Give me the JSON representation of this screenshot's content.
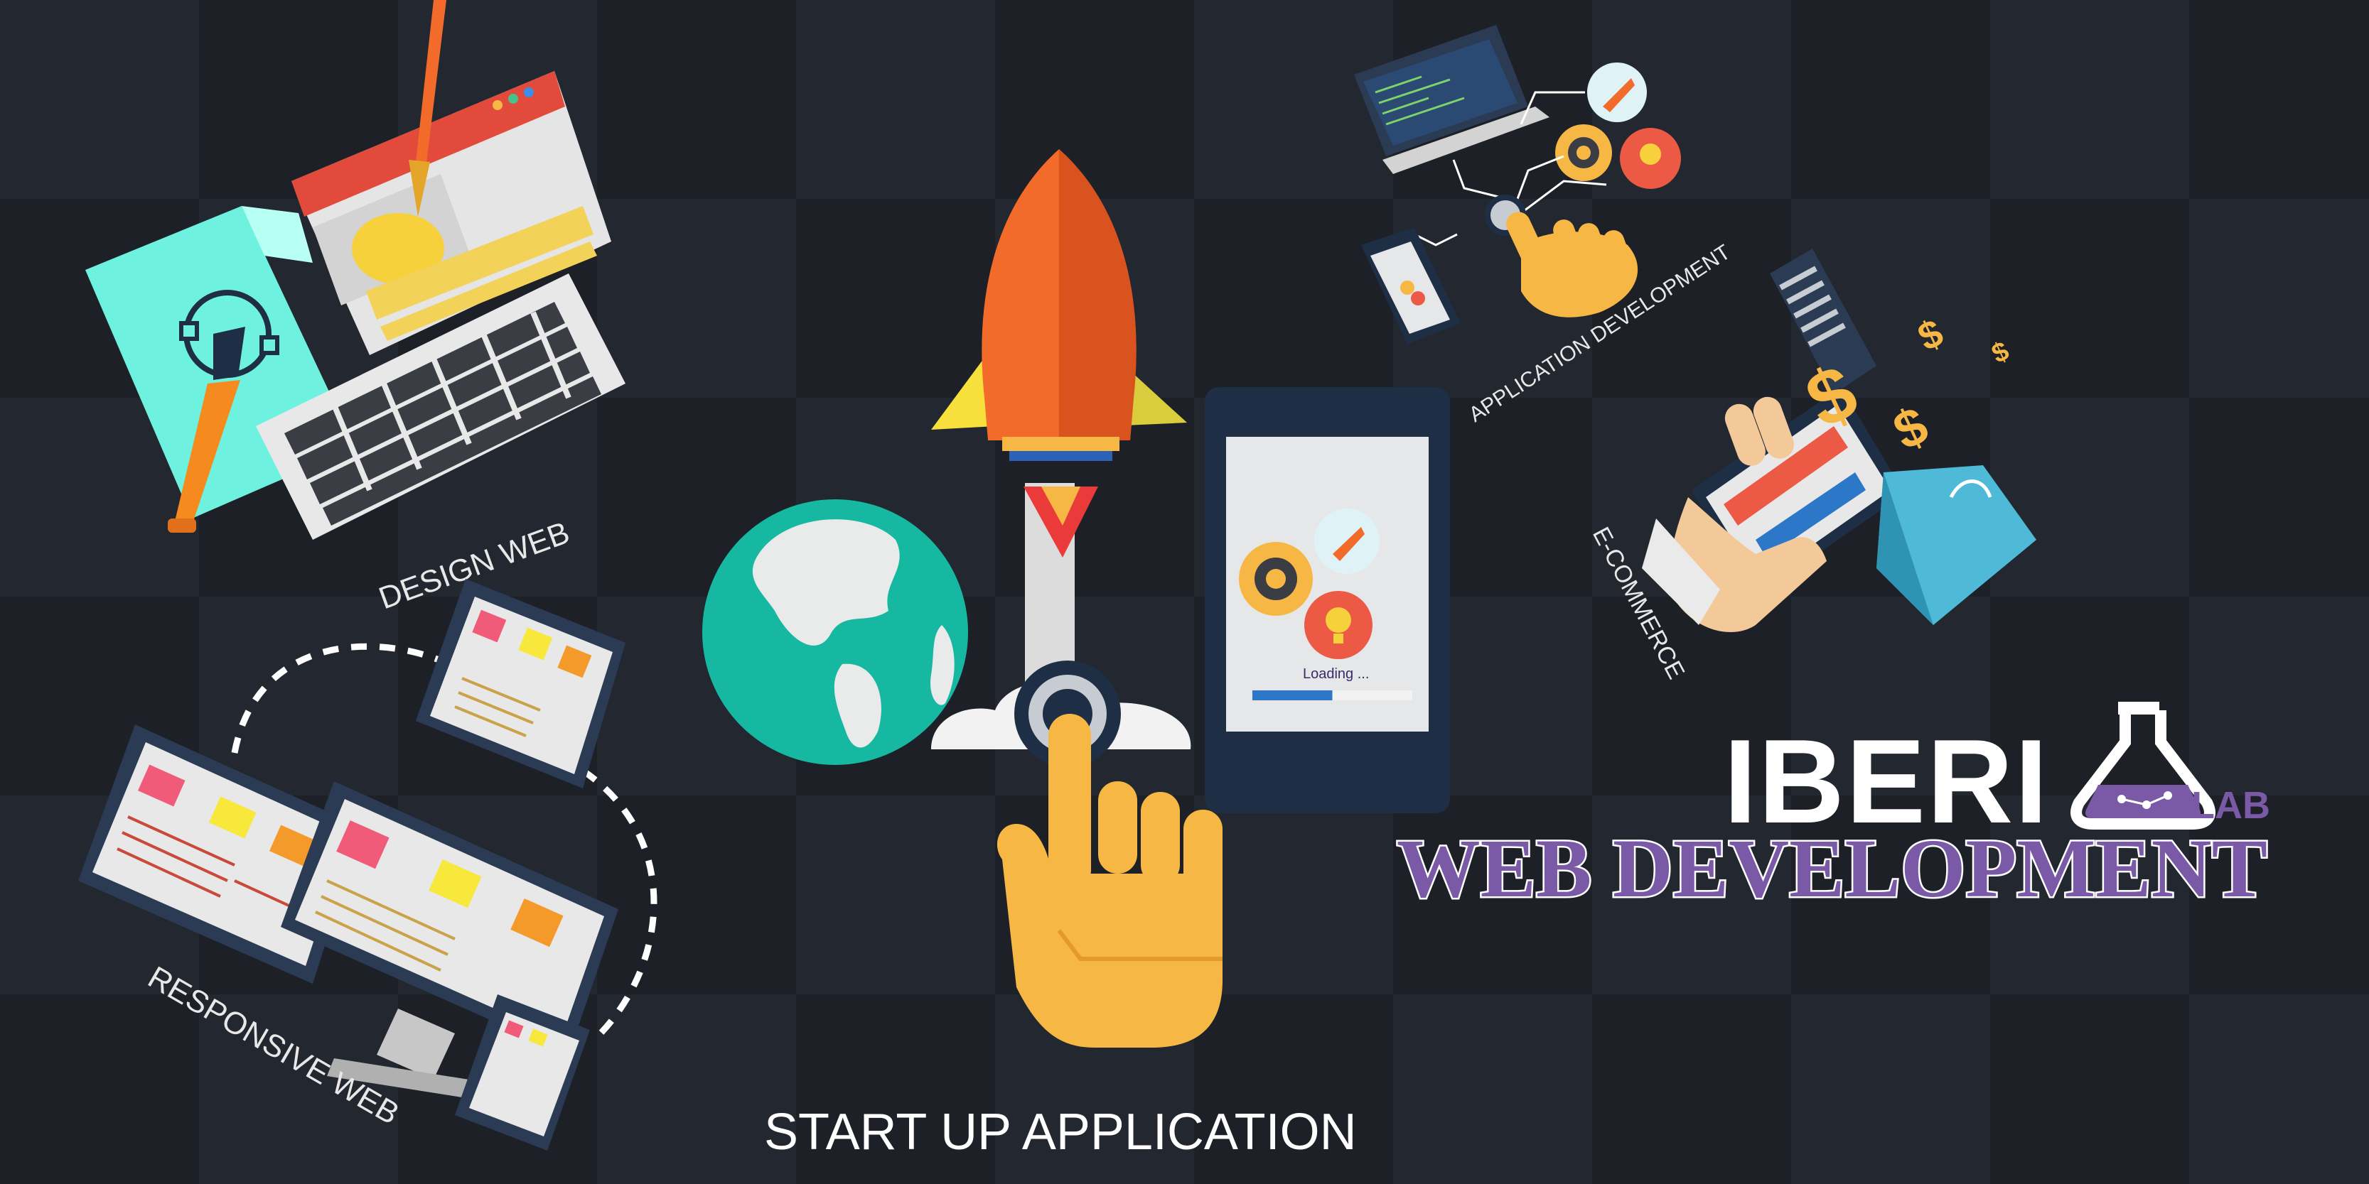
{
  "labels": {
    "design_web": "DESIGN WEB",
    "responsive_web": "RESPONSIVE WEB",
    "start_up_application": "START UP APPLICATION",
    "application_development": "APPLICATION DEVELOPMENT",
    "e_commerce": "E-COMMERCE",
    "phone_loading": "Loading ...",
    "dollar_sign": "$"
  },
  "brand": {
    "name": "IBERI",
    "lab": "LAB",
    "tagline": "WEB DEVELOPMENT"
  },
  "phone_loading_progress": 0.5,
  "colors": {
    "background": "#1d2027",
    "brand_purple": "#7a5aa6",
    "accent_orange": "#f26b2a",
    "accent_yellow": "#f7b744",
    "globe_teal": "#17b8a1",
    "dark_navy": "#1e2f45"
  },
  "icons": [
    "rocket-icon",
    "globe-icon",
    "pointing-hand-icon",
    "gear-icon",
    "lightbulb-icon",
    "flask-icon",
    "keyboard-icon",
    "pen-tool-icon",
    "paintbrush-icon",
    "shopping-bag-icon",
    "credit-card-icon",
    "laptop-icon",
    "monitor-icon",
    "tablet-icon",
    "smartphone-icon"
  ]
}
